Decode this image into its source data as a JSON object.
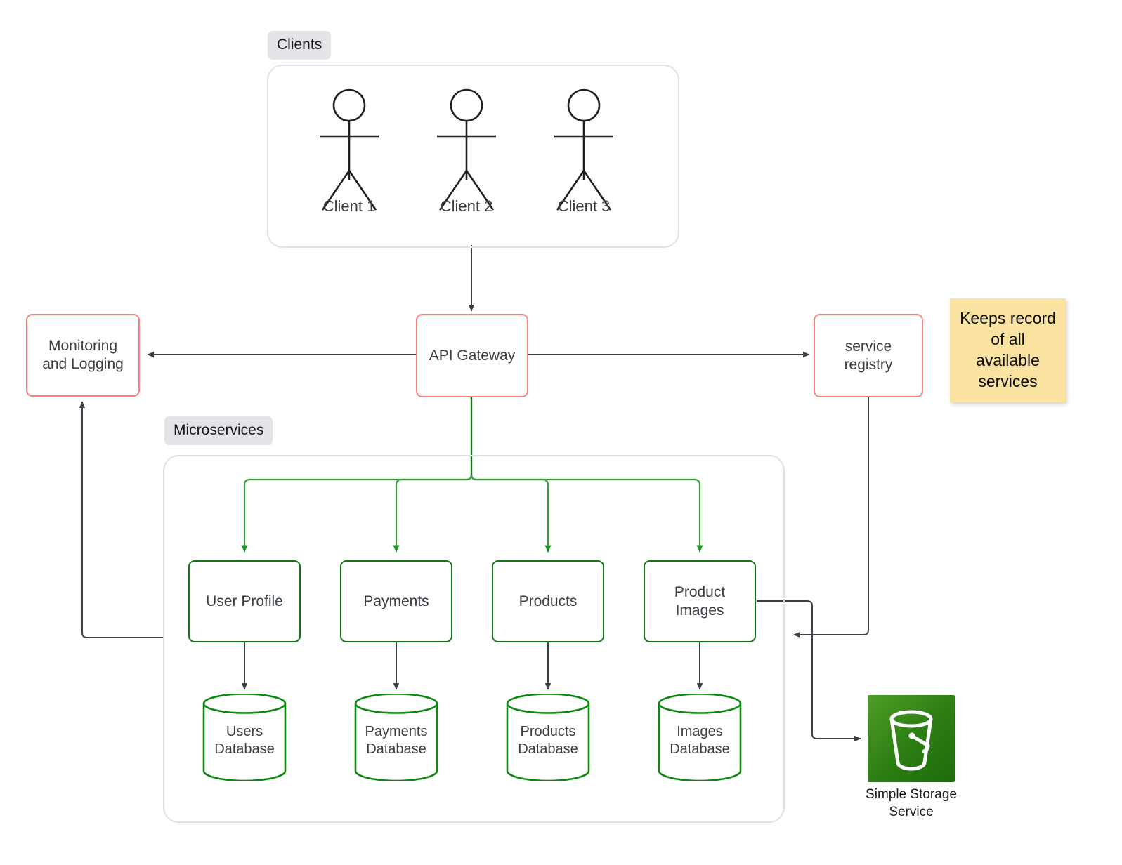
{
  "diagram": {
    "title": "Microservices architecture diagram",
    "colors": {
      "red_border": "#fa8180",
      "green_border": "#117711",
      "group_border": "#dfe2e6",
      "group_label_bg": "#e2e4e7",
      "note_bg": "#fae3a1",
      "connector_gray": "#3c4149",
      "connector_green": "#1e9a26",
      "s3_green": "#2b7d12",
      "text": "#3a3f44"
    }
  },
  "groups": [
    {
      "id": "clients",
      "label": "Clients"
    },
    {
      "id": "microservices",
      "label": "Microservices"
    }
  ],
  "clients": [
    {
      "label": "Client 1"
    },
    {
      "label": "Client 2"
    },
    {
      "label": "Client 3"
    }
  ],
  "nodes": {
    "monitoring": {
      "label": "Monitoring and Logging",
      "line1": "Monitoring",
      "line2": "and Logging",
      "style": "red"
    },
    "api_gateway": {
      "label": "API Gateway",
      "style": "red"
    },
    "service_registry": {
      "label": "service registry",
      "line1": "service",
      "line2": "registry",
      "style": "red"
    }
  },
  "services": [
    {
      "id": "user-profile",
      "label": "User Profile"
    },
    {
      "id": "payments",
      "label": "Payments"
    },
    {
      "id": "products",
      "label": "Products"
    },
    {
      "id": "product-images",
      "label": "Product Images",
      "line1": "Product",
      "line2": "Images"
    }
  ],
  "databases": [
    {
      "id": "users-db",
      "line1": "Users",
      "line2": "Database"
    },
    {
      "id": "payments-db",
      "line1": "Payments",
      "line2": "Database"
    },
    {
      "id": "products-db",
      "line1": "Products",
      "line2": "Database"
    },
    {
      "id": "images-db",
      "line1": "Images",
      "line2": "Database"
    }
  ],
  "note": {
    "text": "Keeps record of all available services"
  },
  "storage": {
    "label": "Simple Storage Service",
    "line1": "Simple Storage",
    "line2": "Service",
    "icon": "s3-bucket-icon"
  }
}
